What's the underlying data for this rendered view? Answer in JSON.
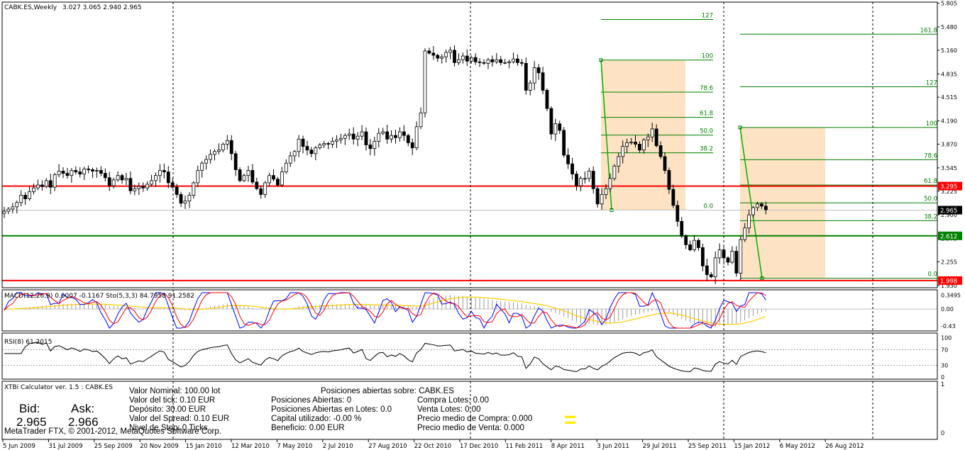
{
  "window": {
    "title": "CABK.ES,Weekly",
    "ohlc": "3.027 3.065 2.940 2.965"
  },
  "colors": {
    "resistance": "#ff0000",
    "support": "#008000",
    "fib": "#008000",
    "zone": "#fde3c3",
    "macd_main": "#ff0000",
    "macd_signal": "#0000ff",
    "stoch_signal": "#ffcc00"
  },
  "chart_data": [
    {
      "type": "candlestick",
      "symbol": "CABK.ES",
      "timeframe": "Weekly",
      "x_tick_labels": [
        "5 Jun 2009",
        "31 Jul 2009",
        "25 Sep 2009",
        "20 Nov 2009",
        "15 Jan 2010",
        "12 Mar 2010",
        "7 May 2010",
        "2 Jul 2010",
        "27 Aug 2010",
        "22 Oct 2010",
        "17 Dec 2010",
        "11 Feb 2011",
        "8 Apr 2011",
        "3 Jun 2011",
        "29 Jul 2011",
        "25 Sep 2011",
        "15 Jan 2012",
        "6 May 2012",
        "26 Aug 2012"
      ],
      "y_tick_labels": [
        "5.805",
        "5.480",
        "5.160",
        "4.835",
        "4.515",
        "4.190",
        "3.870",
        "3.545",
        "3.225",
        "2.900",
        "2.575",
        "2.255",
        "1.930"
      ],
      "ylim": [
        1.9,
        5.82
      ],
      "closes": [
        2.95,
        2.98,
        3.01,
        3.07,
        3.17,
        3.12,
        3.22,
        3.27,
        3.31,
        3.29,
        3.37,
        3.28,
        3.45,
        3.5,
        3.47,
        3.44,
        3.51,
        3.49,
        3.46,
        3.53,
        3.52,
        3.5,
        3.51,
        3.47,
        3.41,
        3.3,
        3.38,
        3.44,
        3.38,
        3.4,
        3.23,
        3.26,
        3.29,
        3.27,
        3.32,
        3.37,
        3.44,
        3.51,
        3.49,
        3.34,
        3.28,
        3.18,
        3.06,
        3.09,
        3.17,
        3.34,
        3.51,
        3.61,
        3.66,
        3.73,
        3.77,
        3.79,
        3.87,
        3.92,
        3.74,
        3.52,
        3.37,
        3.44,
        3.51,
        3.35,
        3.26,
        3.18,
        3.34,
        3.44,
        3.39,
        3.31,
        3.49,
        3.61,
        3.71,
        3.77,
        3.94,
        3.84,
        3.79,
        3.74,
        3.82,
        3.86,
        3.88,
        3.87,
        3.91,
        3.93,
        3.95,
        3.99,
        4.01,
        3.94,
        3.98,
        4.04,
        3.86,
        3.81,
        3.91,
        4.02,
        4.04,
        3.94,
        3.99,
        3.96,
        4.04,
        3.99,
        3.89,
        3.82,
        4.11,
        4.3,
        5.15,
        5.12,
        5.09,
        5.05,
        5.07,
        5.13,
        5.16,
        4.99,
        5.03,
        5.08,
        5.01,
        5.06,
        5.0,
        4.99,
        4.98,
        5.03,
        5.0,
        5.03,
        4.99,
        4.99,
        5.0,
        5.04,
        4.99,
        4.98,
        4.61,
        4.71,
        4.92,
        4.85,
        4.61,
        4.36,
        4.01,
        4.15,
        4.06,
        3.72,
        3.6,
        3.46,
        3.3,
        3.4,
        3.4,
        3.5,
        3.26,
        3.05,
        3.18,
        3.26,
        3.4,
        3.57,
        3.7,
        3.84,
        3.89,
        3.9,
        3.87,
        3.79,
        3.93,
        3.97,
        4.08,
        3.85,
        3.7,
        3.51,
        3.25,
        3.03,
        2.81,
        2.61,
        2.49,
        2.42,
        2.55,
        2.45,
        2.2,
        2.08,
        2.05,
        2.31,
        2.42,
        2.31,
        2.25,
        2.4,
        2.1,
        2.56,
        2.72,
        2.9,
        3.0,
        3.05,
        3.02,
        2.97
      ]
    },
    {
      "type": "line",
      "title": "MACD(12,26,9) 0.0007 -0.1167  Sto(5,3,3) 84.7958 91.2582",
      "y_tick_labels": [
        "0.3495",
        "0.00",
        "-0.43"
      ],
      "ylim": [
        -0.55,
        0.48
      ]
    },
    {
      "type": "line",
      "title": "RSI(8) 61.2015",
      "y_tick_labels": [
        "100",
        "70",
        "30",
        "0"
      ],
      "ylim": [
        -5,
        112
      ],
      "levels": [
        70,
        30
      ]
    }
  ],
  "levels": {
    "resistance": {
      "value": 3.295,
      "label": "3.295"
    },
    "support": {
      "value": 2.612,
      "label": "2.612"
    },
    "low": {
      "value": 1.998,
      "label": "1.998"
    },
    "last": {
      "value": 2.965,
      "label": "2.965"
    }
  },
  "fib1": {
    "low": 2.965,
    "high": 5.025,
    "levels": [
      {
        "ratio": 0,
        "label": "0.0"
      },
      {
        "ratio": 0.382,
        "label": "38.2"
      },
      {
        "ratio": 0.5,
        "label": "50.0"
      },
      {
        "ratio": 0.618,
        "label": "61.8"
      },
      {
        "ratio": 0.786,
        "label": "78.6"
      },
      {
        "ratio": 1,
        "label": "100"
      },
      {
        "ratio": 1.27,
        "label": "127"
      }
    ]
  },
  "fib2": {
    "low": 2.03,
    "high": 4.1,
    "levels": [
      {
        "ratio": 0,
        "label": "0.0"
      },
      {
        "ratio": 0.382,
        "label": "38.2"
      },
      {
        "ratio": 0.5,
        "label": "50.0"
      },
      {
        "ratio": 0.618,
        "label": "61.8"
      },
      {
        "ratio": 0.786,
        "label": "78.6"
      },
      {
        "ratio": 1,
        "label": "100"
      },
      {
        "ratio": 1.27,
        "label": "127"
      },
      {
        "ratio": 1.618,
        "label": "161.8"
      }
    ]
  },
  "calculator": {
    "title": "XTBi Calculator ver. 1.5 : CABK.ES",
    "bid_label": "Bid:",
    "bid_value": "2.965",
    "ask_label": "Ask:",
    "ask_value": "2.966",
    "copyright": "MetaTrader FTX, © 2001-2012, MetaQuotes Software Corp.",
    "col1": [
      "Valor Nominal: 100.00 lot",
      "Valor del tick: 0.10 EUR",
      "Depósito: 30.00 EUR",
      "Valor del Spread: 0.10 EUR",
      "Nivel de Stop: 0 Ticks"
    ],
    "header2": "Posiciones abiertas sobre: CABK.ES",
    "col2": [
      "Posiciones Abiertas: 0",
      "Posiciones Abiertas en Lotes: 0.0",
      "Capital utilizado: -0.00 %",
      "Beneficio: 0.00 EUR"
    ],
    "col3": [
      "Compra Lotes: 0.00",
      "Venta Lotes: 0.00",
      "Precio medio de Compra: 0.000",
      "Precio medio de Venta: 0.000"
    ],
    "equal_sign": "=",
    "sub_labels": [
      "1",
      "0"
    ]
  }
}
